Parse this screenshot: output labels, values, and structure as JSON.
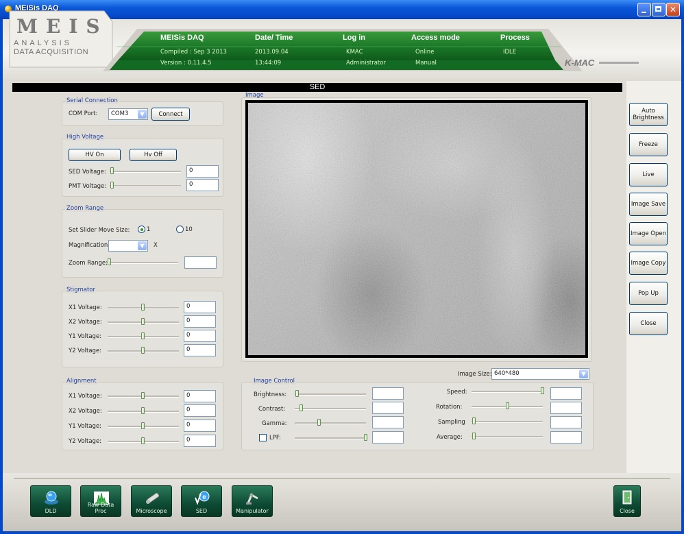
{
  "window": {
    "title": "MEISis DAQ"
  },
  "logo": {
    "main": "MEIS",
    "sub1": "ANALYSIS",
    "sub2": "DATA ACQUISITION",
    "brand": "K-MAC"
  },
  "header": {
    "columns": [
      {
        "label": "MEISis DAQ",
        "line1": "Compiled : Sep  3 2013",
        "line2": "Version : 0.11.4.5"
      },
      {
        "label": "Date/ Time",
        "line1": "2013.09.04",
        "line2": "13:44:09"
      },
      {
        "label": "Log in",
        "line1": "KMAC",
        "line2": "Administrator"
      },
      {
        "label": "Access mode",
        "line1": "Online",
        "line2": "Manual"
      },
      {
        "label": "Process",
        "line1": "IDLE",
        "line2": ""
      }
    ]
  },
  "sed_title": "SED",
  "serial": {
    "title": "Serial Connection",
    "com_label": "COM Port:",
    "com_value": "COM3",
    "connect": "Connect"
  },
  "hv": {
    "title": "High Voltage",
    "on": "HV On",
    "off": "Hv Off",
    "sed_label": "SED Voltage:",
    "sed_value": "0",
    "pmt_label": "PMT Voltage:",
    "pmt_value": "0"
  },
  "zoom": {
    "title": "Zoom Range",
    "move_label": "Set Slider Move Size:",
    "opt1": "1",
    "opt10": "10",
    "mag_label": "Magnification",
    "mag_unit": "X",
    "range_label": "Zoom Range:"
  },
  "stig": {
    "title": "Stigmator",
    "rows": [
      {
        "label": "X1 Voltage:",
        "value": "0"
      },
      {
        "label": "X2 Voltage:",
        "value": "0"
      },
      {
        "label": "Y1 Voltage:",
        "value": "0"
      },
      {
        "label": "Y2 Voltage:",
        "value": "0"
      }
    ]
  },
  "align": {
    "title": "Alignment",
    "rows": [
      {
        "label": "X1 Voltage:",
        "value": "0"
      },
      {
        "label": "X2 Voltage:",
        "value": "0"
      },
      {
        "label": "Y1 Voltage:",
        "value": "0"
      },
      {
        "label": "Y2 Voltage:",
        "value": "0"
      }
    ]
  },
  "image": {
    "title": "Image",
    "size_label": "Image Size:",
    "size_value": "640*480"
  },
  "image_control": {
    "title": "Image Control",
    "left": [
      {
        "label": "Brightness:"
      },
      {
        "label": "Contrast:"
      },
      {
        "label": "Gamma:"
      },
      {
        "label": "LPF:"
      }
    ],
    "right": [
      {
        "label": "Speed:"
      },
      {
        "label": "Rotation:"
      },
      {
        "label": "Sampling"
      },
      {
        "label": "Average:"
      }
    ]
  },
  "side_buttons": [
    "Auto Brightness",
    "Freeze",
    "Live",
    "Image Save",
    "Image Open",
    "Image Copy",
    "Pop Up",
    "Close"
  ],
  "dock": [
    {
      "label": "DLD",
      "icon": "globe-icon"
    },
    {
      "label": "Raw Data Proc",
      "icon": "spectrum-icon"
    },
    {
      "label": "Microscope",
      "icon": "microscope-icon"
    },
    {
      "label": "SED",
      "icon": "sed-icon"
    },
    {
      "label": "Manipulator",
      "icon": "robot-arm-icon"
    }
  ],
  "dock_close": {
    "label": "Close",
    "icon": "exit-door-icon"
  },
  "colors": {
    "title_bar": "#0548c8",
    "header_green": "#1c7a2a",
    "accent_label": "#2040a0"
  }
}
